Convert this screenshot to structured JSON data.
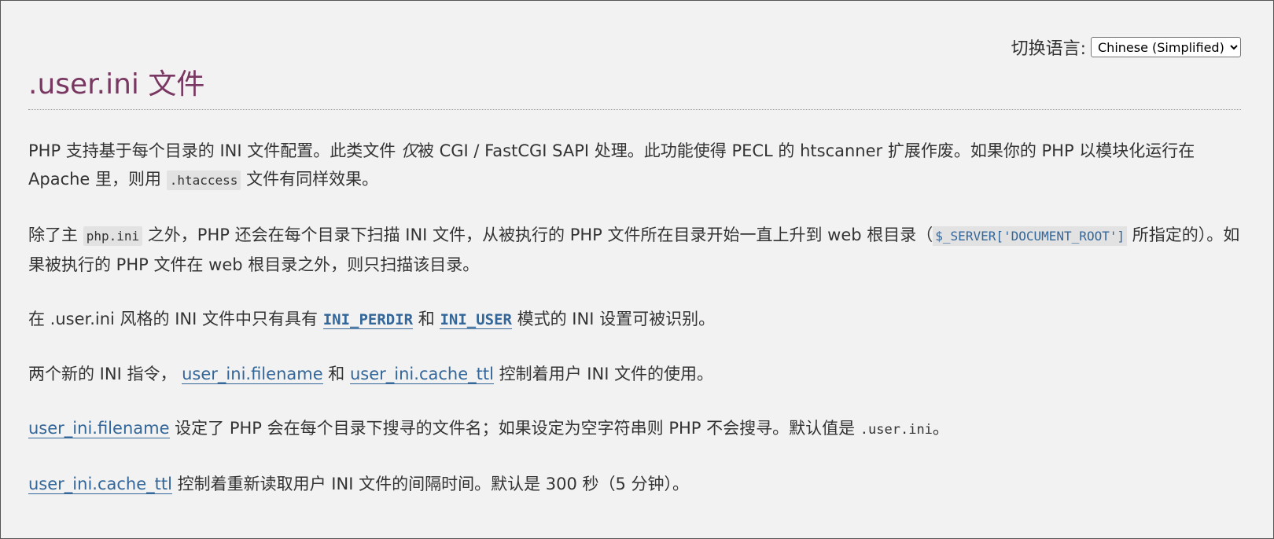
{
  "lang_switch": {
    "label": "切换语言:",
    "selected": "Chinese (Simplified)"
  },
  "title": ".user.ini 文件",
  "p1": {
    "a": "PHP 支持基于每个目录的 INI 文件配置。此类文件 ",
    "em": "仅",
    "b": "被 CGI / FastCGI SAPI 处理。此功能使得 PECL 的 htscanner 扩展作废。如果你的 PHP 以模块化运行在 Apache 里，则用 ",
    "code": ".htaccess",
    "c": " 文件有同样效果。"
  },
  "p2": {
    "a": "除了主 ",
    "code": "php.ini",
    "b": " 之外，PHP 还会在每个目录下扫描 INI 文件，从被执行的 PHP 文件所在目录开始一直上升到 web 根目录（",
    "link": "$_SERVER['DOCUMENT_ROOT']",
    "c": " 所指定的）。如果被执行的 PHP 文件在 web 根目录之外，则只扫描该目录。"
  },
  "p3": {
    "a": "在 .user.ini 风格的 INI 文件中只有具有 ",
    "const1": "INI_PERDIR",
    "b": " 和 ",
    "const2": "INI_USER",
    "c": " 模式的 INI 设置可被识别。"
  },
  "p4": {
    "a": "两个新的 INI 指令， ",
    "link1": "user_ini.filename",
    "b": " 和 ",
    "link2": "user_ini.cache_ttl",
    "c": " 控制着用户 INI 文件的使用。"
  },
  "p5": {
    "link": "user_ini.filename",
    "a": " 设定了 PHP 会在每个目录下搜寻的文件名；如果设定为空字符串则 PHP 不会搜寻。默认值是 ",
    "code": ".user.ini",
    "b": "。"
  },
  "p6": {
    "link": "user_ini.cache_ttl",
    "a": " 控制着重新读取用户 INI 文件的间隔时间。默认是 300 秒（5 分钟）。"
  }
}
